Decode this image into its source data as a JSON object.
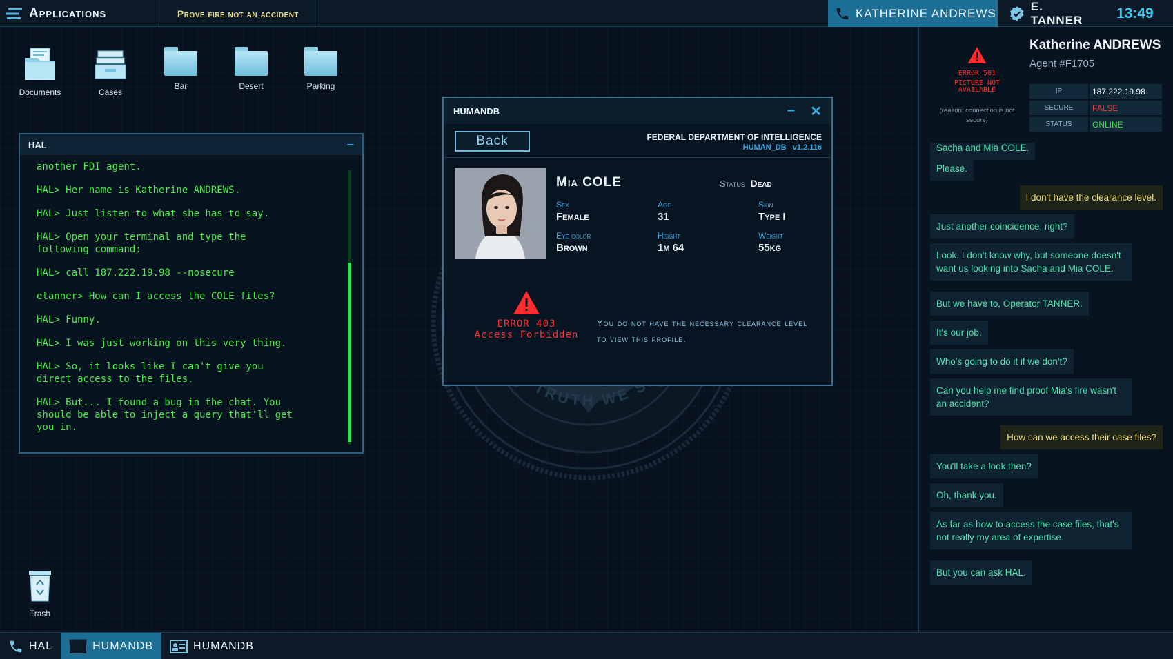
{
  "topbar": {
    "apps_label": "Applications",
    "mission": "Prove fire not an accident",
    "call_name": "KATHERINE ANDREWS",
    "user": "E. TANNER",
    "clock": "13:49"
  },
  "desktop": {
    "icons": [
      {
        "label": "Documents"
      },
      {
        "label": "Cases"
      },
      {
        "label": "Bar"
      },
      {
        "label": "Desert"
      },
      {
        "label": "Parking"
      }
    ],
    "trash": "Trash"
  },
  "hal": {
    "title": "HAL",
    "lines": [
      "another FDI agent.",
      "HAL> Her name is Katherine ANDREWS.",
      "HAL> Just listen to what she has to say.",
      "HAL> Open your terminal and type the\nfollowing command:",
      "HAL> call 187.222.19.98 --nosecure",
      "etanner> How can I access the COLE files?",
      "HAL> Funny.",
      "HAL> I was just working on this very thing.",
      "HAL> So, it looks like I can't give you\ndirect access to the files.",
      "HAL> But... I found a bug in the chat. You\nshould be able to inject a query that'll get\nyou in."
    ]
  },
  "humandb": {
    "title": "HUMANDB",
    "back": "Back",
    "agency": "FEDERAL DEPARTMENT OF INTELLIGENCE",
    "app": "HUMAN_DB",
    "version": "v1.2.116",
    "name": "Mia COLE",
    "status_label": "Status",
    "status": "Dead",
    "fields": {
      "sex": {
        "k": "Sex",
        "v": "Female"
      },
      "age": {
        "k": "Age",
        "v": "31"
      },
      "skin": {
        "k": "Skin",
        "v": "Type I"
      },
      "eye": {
        "k": "Eye color",
        "v": "Brown"
      },
      "height": {
        "k": "Height",
        "v": "1m 64"
      },
      "weight": {
        "k": "Weight",
        "v": "55kg"
      }
    },
    "error_code": "ERROR 403",
    "error_text": "Access Forbidden",
    "error_msg": "You do not have the necessary clearance level to view this profile."
  },
  "contact": {
    "name": "Katherine ANDREWS",
    "agent": "Agent #F1705",
    "error_code": "ERROR 501",
    "error_text": "PICTURE NOT AVAILABLE",
    "error_reason": "(reason: connection is not secure)",
    "ip_label": "IP",
    "ip": "187.222.19.98",
    "secure_label": "SECURE",
    "secure": "FALSE",
    "status_label": "STATUS",
    "status": "ONLINE",
    "colors": {
      "false": "#ff3b3b",
      "online": "#3fe04f"
    }
  },
  "chat": [
    {
      "dir": "in",
      "text": "Sacha and Mia COLE."
    },
    {
      "dir": "in",
      "text": "Please."
    },
    {
      "dir": "out",
      "text": "I don't have the clearance level."
    },
    {
      "dir": "in",
      "text": "Just another coincidence, right?"
    },
    {
      "dir": "in",
      "text": "Look. I don't know why, but someone doesn't want us looking into Sacha and Mia COLE."
    },
    {
      "dir": "in",
      "text": "But we have to, Operator TANNER."
    },
    {
      "dir": "in",
      "text": "It's our job."
    },
    {
      "dir": "in",
      "text": "Who's going to do it if we don't?"
    },
    {
      "dir": "in",
      "text": "Can you help me find proof Mia's fire wasn't an accident?"
    },
    {
      "dir": "out",
      "text": "How can we access their case files?"
    },
    {
      "dir": "in",
      "text": "You'll take a look then?"
    },
    {
      "dir": "in",
      "text": "Oh, thank you."
    },
    {
      "dir": "in",
      "text": "As far as how to access the case files, that's not really my area of expertise."
    },
    {
      "dir": "in",
      "text": "But you can ask HAL."
    }
  ],
  "seal_text": "THE TRUTH WE SEEK",
  "taskbar": [
    {
      "label": "HAL",
      "icon": "phone-icon",
      "active": false
    },
    {
      "label": "HUMANDB",
      "icon": "window-icon",
      "active": true
    },
    {
      "label": "HUMANDB",
      "icon": "id-card-icon",
      "active": false
    }
  ]
}
